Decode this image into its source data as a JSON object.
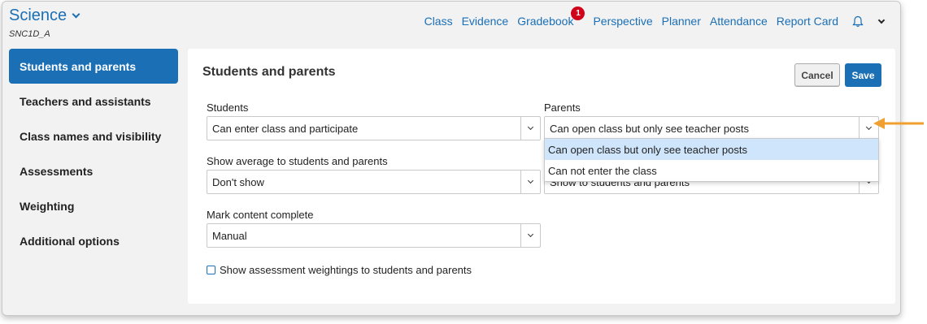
{
  "header": {
    "course_title": "Science",
    "course_code": "SNC1D_A",
    "nav": [
      "Class",
      "Evidence",
      "Gradebook",
      "Perspective",
      "Planner",
      "Attendance",
      "Report Card"
    ],
    "gradebook_badge": "1"
  },
  "sidebar": {
    "items": [
      {
        "label": "Students and parents",
        "active": true
      },
      {
        "label": "Teachers and assistants",
        "active": false
      },
      {
        "label": "Class names and visibility",
        "active": false
      },
      {
        "label": "Assessments",
        "active": false
      },
      {
        "label": "Weighting",
        "active": false
      },
      {
        "label": "Additional options",
        "active": false
      }
    ]
  },
  "panel": {
    "title": "Students and parents",
    "cancel_label": "Cancel",
    "save_label": "Save",
    "students": {
      "label": "Students",
      "value": "Can enter class and participate"
    },
    "parents": {
      "label": "Parents",
      "value": "Can open class but only see teacher posts",
      "options": [
        "Can open class but only see teacher posts",
        "Can not enter the class"
      ],
      "selected_index": 0
    },
    "show_average": {
      "label": "Show average to students and parents",
      "value": "Don't show"
    },
    "hidden_select_value": "Show to students and parents",
    "mark_complete": {
      "label": "Mark content complete",
      "value": "Manual"
    },
    "weightings_checkbox": {
      "label": "Show assessment weightings to students and parents",
      "checked": false
    }
  },
  "colors": {
    "accent": "#1a6fb5",
    "badge": "#d0021b",
    "dropdown_highlight": "#cfe5fb",
    "callout_arrow": "#f0a030"
  }
}
